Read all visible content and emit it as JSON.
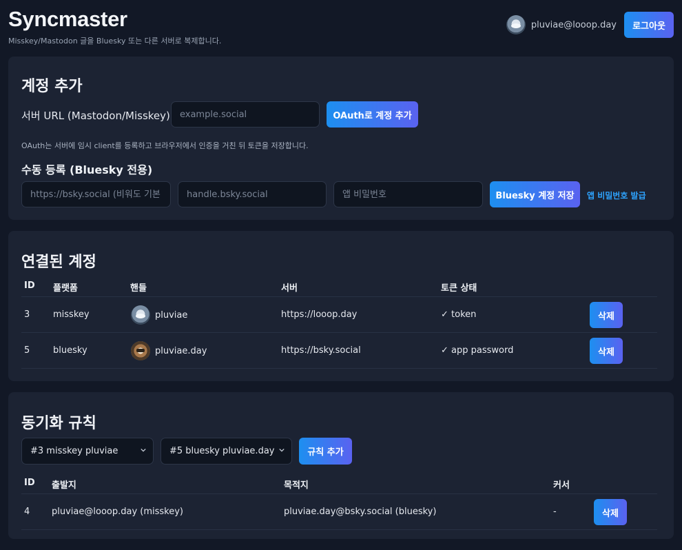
{
  "header": {
    "title": "Syncmaster",
    "subtitle": "Misskey/Mastodon 글을 Bluesky 또는 다른 서버로 복제합니다.",
    "user_email": "pluviae@looop.day",
    "logout_label": "로그아웃"
  },
  "add_account": {
    "title": "계정 추가",
    "server_url_label": "서버 URL (Mastodon/Misskey)",
    "server_url_placeholder": "example.social",
    "oauth_button": "OAuth로 계정 추가",
    "hint": "OAuth는 서버에 임시 client를 등록하고 브라우저에서 인증을 거친 뒤 토큰을 저장합니다.",
    "manual_title": "수동 등록 (Bluesky 전용)",
    "pds_placeholder": "https://bsky.social (비워도 기본",
    "handle_placeholder": "handle.bsky.social",
    "app_password_placeholder": "앱 비밀번호",
    "save_button": "Bluesky 계정 저장",
    "issue_link": "앱 비밀번호 발급"
  },
  "accounts": {
    "title": "연결된 계정",
    "columns": [
      "ID",
      "플랫폼",
      "핸들",
      "서버",
      "토큰 상태"
    ],
    "rows": [
      {
        "id": "3",
        "platform": "misskey",
        "handle": "pluviae",
        "server": "https://looop.day",
        "token": "✓ token",
        "delete": "삭제"
      },
      {
        "id": "5",
        "platform": "bluesky",
        "handle": "pluviae.day",
        "server": "https://bsky.social",
        "token": "✓ app password",
        "delete": "삭제"
      }
    ]
  },
  "rules": {
    "title": "동기화 규칙",
    "source_select": "#3 misskey pluviae",
    "target_select": "#5 bluesky pluviae.day",
    "add_button": "규칙 추가",
    "columns": [
      "ID",
      "출발지",
      "목적지",
      "커서"
    ],
    "rows": [
      {
        "id": "4",
        "source": "pluviae@looop.day (misskey)",
        "target": "pluviae.day@bsky.social (bluesky)",
        "cursor": "-",
        "delete": "삭제"
      }
    ]
  },
  "colors": {
    "background": "#121826",
    "card": "#1c2333",
    "accent_start": "#1d8ff0",
    "accent_end": "#5a62f0",
    "link": "#2ea4ff"
  },
  "icons": {
    "avatar_misskey": "avatar-icon",
    "avatar_bluesky": "avatar-icon",
    "select_arrow": "chevron-down-icon"
  }
}
